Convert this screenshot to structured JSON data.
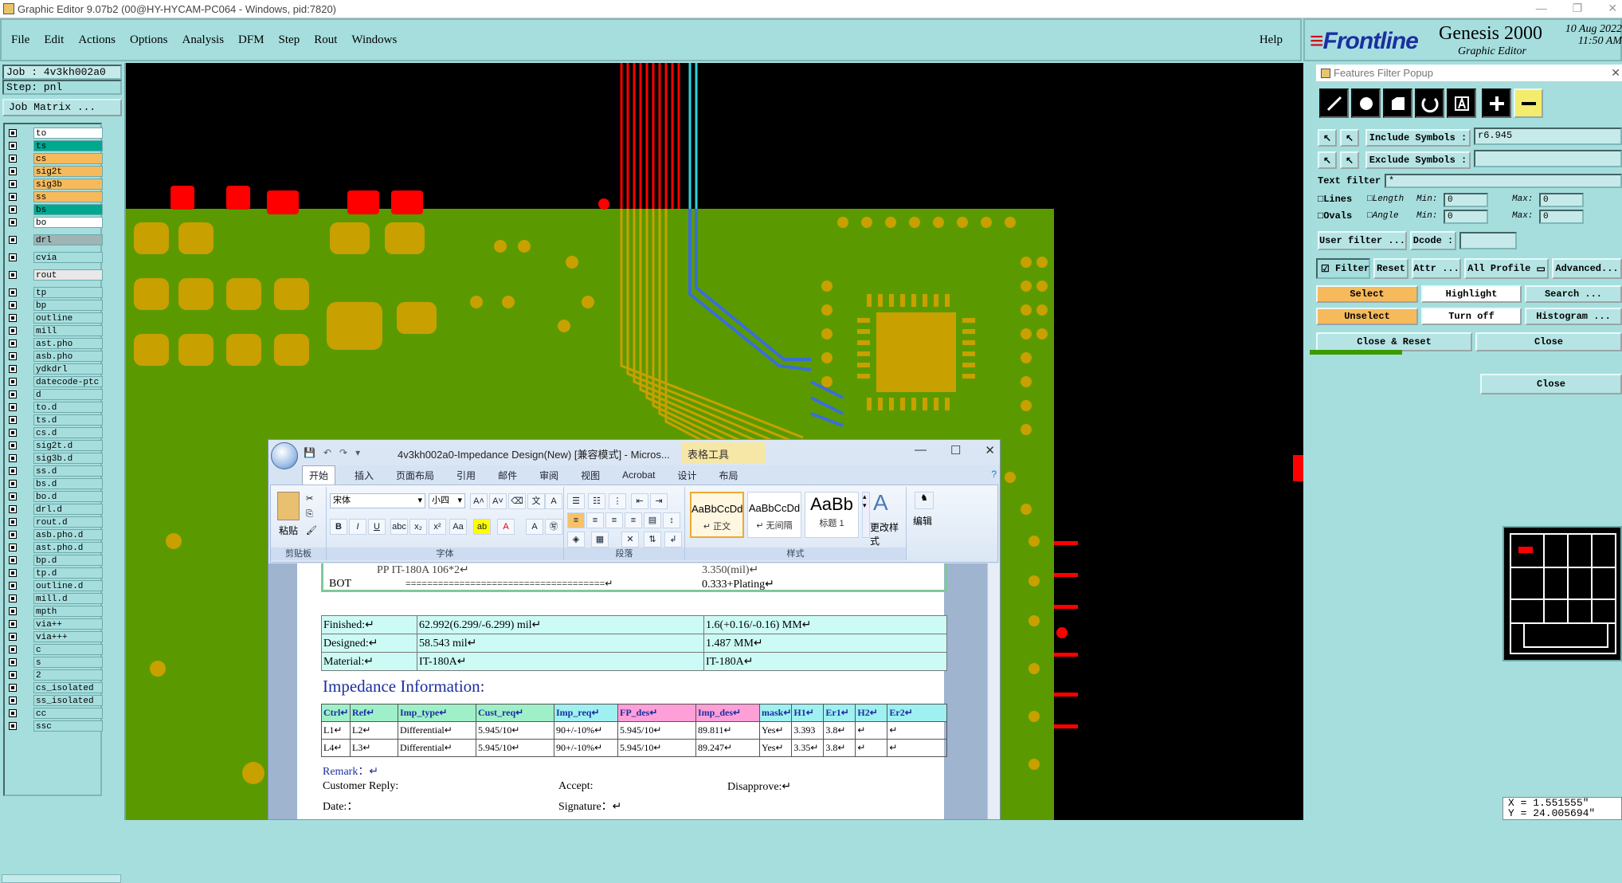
{
  "window": {
    "title": "Graphic Editor 9.07b2 (00@HY-HYCAM-PC064 - Windows, pid:7820)"
  },
  "menu": {
    "items": [
      "File",
      "Edit",
      "Actions",
      "Options",
      "Analysis",
      "DFM",
      "Step",
      "Rout",
      "Windows"
    ],
    "help": "Help"
  },
  "brand": {
    "frontline": "Frontline",
    "genesis": "Genesis 2000",
    "editor": "Graphic Editor",
    "date": "10 Aug 2022",
    "time": "11:50 AM"
  },
  "job": {
    "job_label": "Job : 4v3kh002a0",
    "step_label": "Step: pnl",
    "matrix_button": "Job Matrix ..."
  },
  "layers": [
    {
      "name": "to",
      "color": "#ffffff"
    },
    {
      "name": "ts",
      "color": "#00a890"
    },
    {
      "name": "cs",
      "color": "#f6ba5c"
    },
    {
      "name": "sig2t",
      "color": "#f6ba5c"
    },
    {
      "name": "sig3b",
      "color": "#f6ba5c"
    },
    {
      "name": "ss",
      "color": "#f6ba5c"
    },
    {
      "name": "bs",
      "color": "#00a890"
    },
    {
      "name": "bo",
      "color": "#ffffff"
    },
    {
      "name": "drl",
      "color": "#9fb4b4",
      "gap": true
    },
    {
      "name": "cvia",
      "color": "#a6dede",
      "gap": true
    },
    {
      "name": "rout",
      "color": "#e8e8e8",
      "gap": true
    },
    {
      "name": "tp",
      "color": "#a6dede",
      "gap": true
    },
    {
      "name": "bp",
      "color": "#a6dede"
    },
    {
      "name": "outline",
      "color": "#a6dede"
    },
    {
      "name": "mill",
      "color": "#a6dede"
    },
    {
      "name": "ast.pho",
      "color": "#a6dede"
    },
    {
      "name": "asb.pho",
      "color": "#a6dede"
    },
    {
      "name": "ydkdrl",
      "color": "#a6dede"
    },
    {
      "name": "datecode-ptc",
      "color": "#a6dede"
    },
    {
      "name": "d",
      "color": "#a6dede"
    },
    {
      "name": "to.d",
      "color": "#a6dede"
    },
    {
      "name": "ts.d",
      "color": "#a6dede"
    },
    {
      "name": "cs.d",
      "color": "#a6dede"
    },
    {
      "name": "sig2t.d",
      "color": "#a6dede"
    },
    {
      "name": "sig3b.d",
      "color": "#a6dede"
    },
    {
      "name": "ss.d",
      "color": "#a6dede"
    },
    {
      "name": "bs.d",
      "color": "#a6dede"
    },
    {
      "name": "bo.d",
      "color": "#a6dede"
    },
    {
      "name": "drl.d",
      "color": "#a6dede"
    },
    {
      "name": "rout.d",
      "color": "#a6dede"
    },
    {
      "name": "asb.pho.d",
      "color": "#a6dede"
    },
    {
      "name": "ast.pho.d",
      "color": "#a6dede"
    },
    {
      "name": "bp.d",
      "color": "#a6dede"
    },
    {
      "name": "tp.d",
      "color": "#a6dede"
    },
    {
      "name": "outline.d",
      "color": "#a6dede"
    },
    {
      "name": "mill.d",
      "color": "#a6dede"
    },
    {
      "name": "mpth",
      "color": "#a6dede"
    },
    {
      "name": "via++",
      "color": "#a6dede"
    },
    {
      "name": "via+++",
      "color": "#a6dede"
    },
    {
      "name": "c",
      "color": "#a6dede"
    },
    {
      "name": "s",
      "color": "#a6dede"
    },
    {
      "name": "2",
      "color": "#a6dede"
    },
    {
      "name": "cs_isolated",
      "color": "#a6dede"
    },
    {
      "name": "ss_isolated",
      "color": "#a6dede"
    },
    {
      "name": "cc",
      "color": "#a6dede"
    },
    {
      "name": "ssc",
      "color": "#a6dede"
    }
  ],
  "filter_popup": {
    "title": "Features Filter Popup",
    "include_label": "Include Symbols :",
    "include_value": "r6.945",
    "exclude_label": "Exclude Symbols :",
    "exclude_value": "",
    "text_filter_label": "Text filter",
    "text_filter_value": "*",
    "lines": "Lines",
    "ovals": "Ovals",
    "length": "Length",
    "angle": "Angle",
    "min": "Min:",
    "max": "Max:",
    "min_len": "0",
    "max_len": "0",
    "min_ang": "0",
    "max_ang": "0",
    "user_filter": "User filter ...",
    "dcode": "Dcode :",
    "filter": "Filter",
    "reset": "Reset",
    "attr": "Attr ...",
    "profile": "All Profile",
    "advanced": "Advanced...",
    "select": "Select",
    "highlight": "Highlight",
    "search": "Search ...",
    "unselect": "Unselect",
    "turn_off": "Turn off",
    "histogram": "Histogram ...",
    "close_reset": "Close & Reset",
    "close": "Close",
    "close2": "Close"
  },
  "coords": {
    "x": "X = 1.551555\"",
    "y": "Y = 24.005694\""
  },
  "word": {
    "title": "4v3kh002a0-Impedance Design(New) [兼容模式] - Micros...",
    "context_tab": "表格工具",
    "tabs": [
      "开始",
      "插入",
      "页面布局",
      "引用",
      "邮件",
      "审阅",
      "视图",
      "Acrobat",
      "设计",
      "布局"
    ],
    "font_name": "宋体",
    "font_size": "小四",
    "paste": "粘贴",
    "groups": [
      "剪贴板",
      "字体",
      "段落",
      "样式",
      "编辑"
    ],
    "styles": [
      {
        "sample": "AaBbCcDd",
        "name": "↵ 正文"
      },
      {
        "sample": "AaBbCcDd",
        "name": "↵ 无间隔"
      },
      {
        "sample": "AaBb",
        "name": "标题 1"
      }
    ],
    "change_styles": "更改样式",
    "edit": "编辑",
    "stack_pp": "PP      IT-180A    106*2↵",
    "stack_pp_val": "3.350(mil)↵",
    "stack_bot": "BOT",
    "stack_bot_line": "=====================================↵",
    "stack_bot_val": "0.333+Plating↵",
    "thick_rows": [
      {
        "label": "Finished:↵",
        "mil": "62.992(6.299/-6.299) mil↵",
        "mm": "1.6(+0.16/-0.16) MM↵"
      },
      {
        "label": "Designed:↵",
        "mil": "58.543 mil↵",
        "mm": "1.487 MM↵"
      },
      {
        "label": "Material:↵",
        "mil": "IT-180A↵",
        "mm": "IT-180A↵"
      }
    ],
    "impedance_heading": "Impedance Information:",
    "imp_headers": [
      "Ctrl↵",
      "Ref↵",
      "Imp_type↵",
      "Cust_req↵",
      "Imp_req↵",
      "FP_des↵",
      "Imp_des↵",
      "mask↵",
      "H1↵",
      "Er1↵",
      "H2↵",
      "Er2↵"
    ],
    "imp_rows": [
      [
        "L1↵",
        "L2↵",
        "Differential↵",
        "5.945/10↵",
        "90+/-10%↵",
        "5.945/10↵",
        "89.811↵",
        "Yes↵",
        "3.393",
        "3.8↵",
        "↵",
        "↵"
      ],
      [
        "L4↵",
        "L3↵",
        "Differential↵",
        "5.945/10↵",
        "90+/-10%↵",
        "5.945/10↵",
        "89.247↵",
        "Yes↵",
        "3.35↵",
        "3.8↵",
        "↵",
        "↵"
      ]
    ],
    "remark": "Remark：↵",
    "customer_reply": "Customer Reply:",
    "accept": "Accept:",
    "disapprove": "Disapprove:↵",
    "date": "Date:：",
    "signature": "Signature：↵"
  }
}
